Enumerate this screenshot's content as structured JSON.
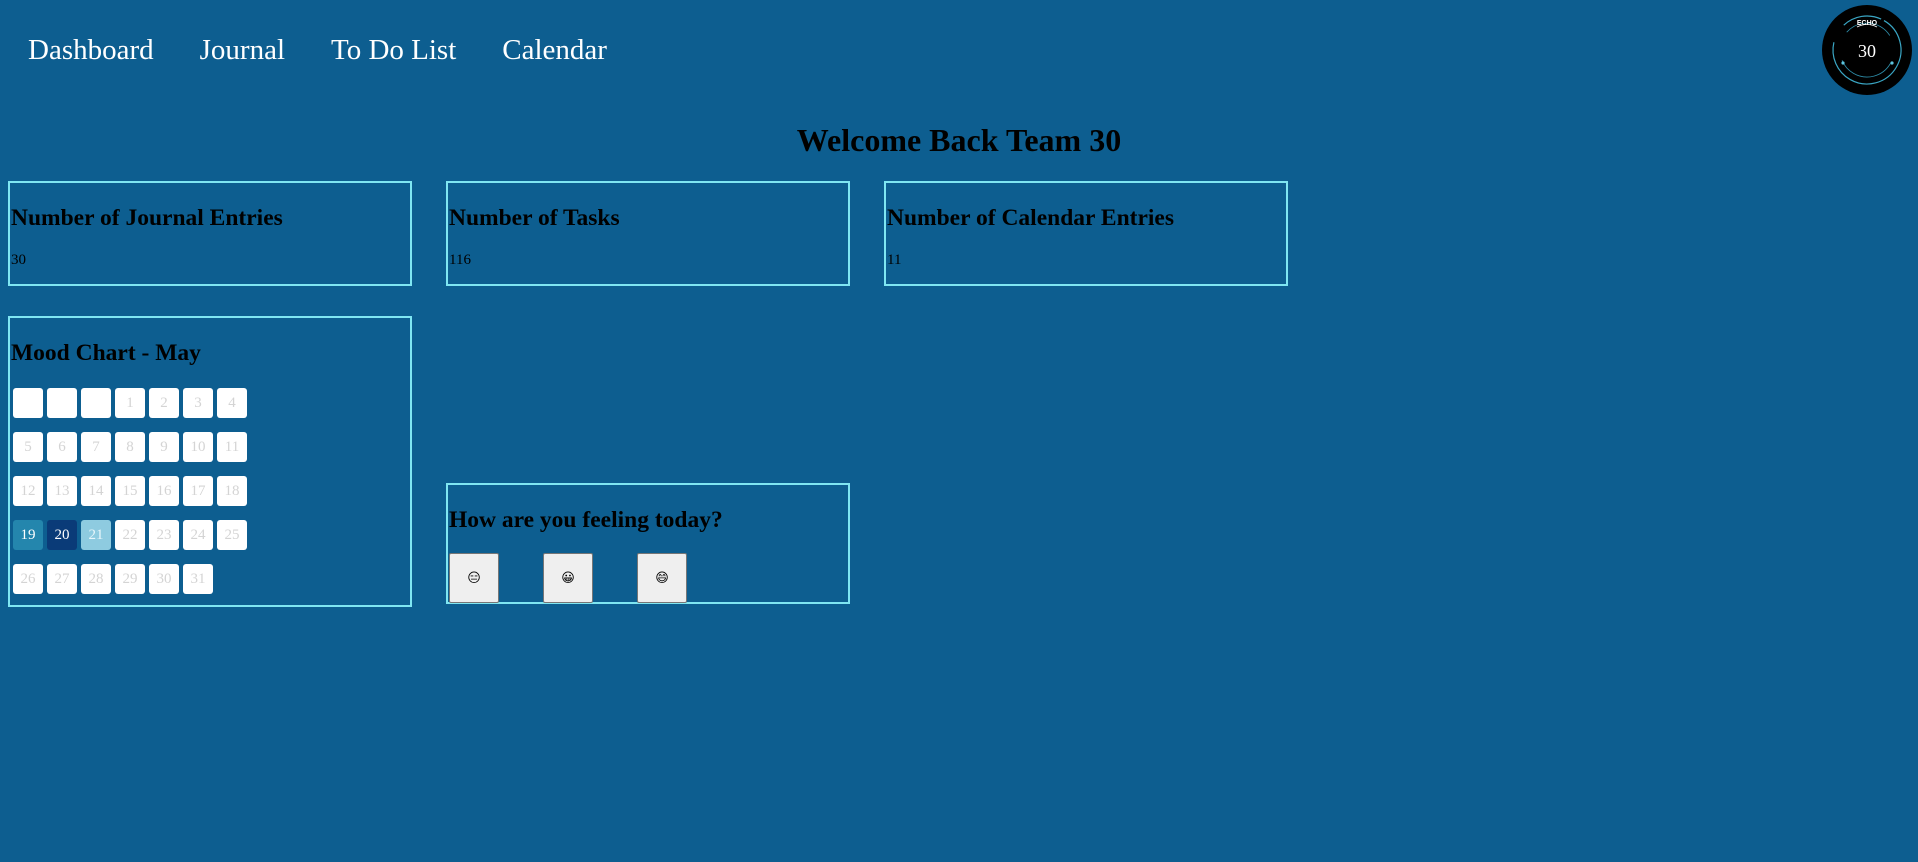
{
  "nav": {
    "items": [
      {
        "label": "Dashboard"
      },
      {
        "label": "Journal"
      },
      {
        "label": "To Do List"
      },
      {
        "label": "Calendar"
      }
    ]
  },
  "logo": {
    "top_text": "ECHO",
    "number": "30"
  },
  "welcome": "Welcome Back Team 30",
  "stats": {
    "journal": {
      "title": "Number of Journal Entries",
      "value": "30"
    },
    "tasks": {
      "title": "Number of Tasks",
      "value": "116"
    },
    "calendar": {
      "title": "Number of Calendar Entries",
      "value": "11"
    }
  },
  "mood_chart": {
    "title": "Mood Chart - May",
    "days": [
      {
        "label": ""
      },
      {
        "label": ""
      },
      {
        "label": ""
      },
      {
        "label": "1"
      },
      {
        "label": "2"
      },
      {
        "label": "3"
      },
      {
        "label": "4"
      },
      {
        "label": "5"
      },
      {
        "label": "6"
      },
      {
        "label": "7"
      },
      {
        "label": "8"
      },
      {
        "label": "9"
      },
      {
        "label": "10"
      },
      {
        "label": "11"
      },
      {
        "label": "12"
      },
      {
        "label": "13"
      },
      {
        "label": "14"
      },
      {
        "label": "15"
      },
      {
        "label": "16"
      },
      {
        "label": "17"
      },
      {
        "label": "18"
      },
      {
        "label": "19",
        "mood": 1
      },
      {
        "label": "20",
        "mood": 2
      },
      {
        "label": "21",
        "mood": 3
      },
      {
        "label": "22"
      },
      {
        "label": "23"
      },
      {
        "label": "24"
      },
      {
        "label": "25"
      },
      {
        "label": "26"
      },
      {
        "label": "27"
      },
      {
        "label": "28"
      },
      {
        "label": "29"
      },
      {
        "label": "30"
      },
      {
        "label": "31"
      }
    ],
    "mood_colors": {
      "1": "#2486ad",
      "2": "#0a3b78",
      "3": "#8ecbe0"
    }
  },
  "feeling": {
    "title": "How are you feeling today?",
    "sad": "😑",
    "neutral": "😀",
    "happy": "😄"
  },
  "colors": {
    "background": "#0d5e90",
    "card_border": "#7fe6f2"
  }
}
